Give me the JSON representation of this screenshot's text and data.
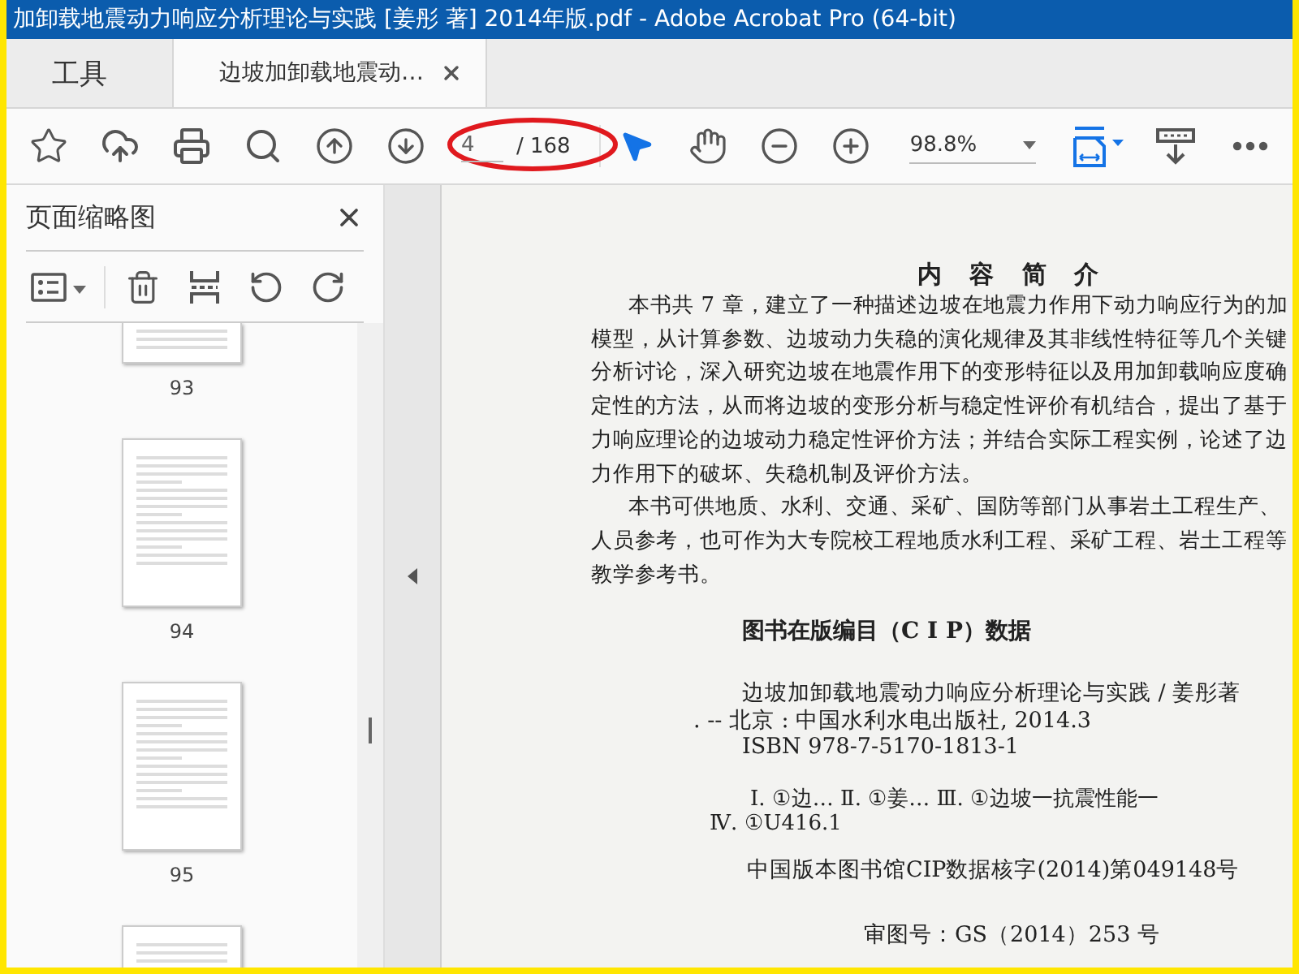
{
  "window": {
    "title": "加卸载地震动力响应分析理论与实践 [姜彤 著] 2014年版.pdf - Adobe Acrobat Pro (64-bit)"
  },
  "tabs": [
    {
      "label": "工具",
      "selected": false,
      "closable": false
    },
    {
      "label": "边坡加卸载地震动…",
      "selected": true,
      "closable": true
    }
  ],
  "toolbar": {
    "page_input": "4",
    "page_total": "/ 168",
    "zoom": "98.8%"
  },
  "sidebar": {
    "title": "页面缩略图",
    "thumbnails": [
      {
        "kind": "top_cut",
        "label": "93"
      },
      {
        "kind": "full",
        "label": "94"
      },
      {
        "kind": "full",
        "label": "95"
      },
      {
        "kind": "bottom_cut"
      }
    ]
  },
  "document": {
    "lines": [
      {
        "kind": "heading",
        "text": "内 容 简 介"
      },
      {
        "kind": "para_first",
        "text": "本书共 7 章，建立了一种描述边坡在地震力作用下动力响应行为的加"
      },
      {
        "kind": "para",
        "text": "模型，从计算参数、边坡动力失稳的演化规律及其非线性特征等几个关键"
      },
      {
        "kind": "para",
        "text": "分析讨论，深入研究边坡在地震作用下的变形特征以及用加卸载响应度确"
      },
      {
        "kind": "para",
        "text": "定性的方法，从而将边坡的变形分析与稳定性评价有机结合，提出了基于"
      },
      {
        "kind": "para",
        "text": "力响应理论的边坡动力稳定性评价方法；并结合实际工程实例，论述了边"
      },
      {
        "kind": "para",
        "text": "力作用下的破坏、失稳机制及评价方法。"
      },
      {
        "kind": "para_first",
        "text": "本书可供地质、水利、交通、采矿、国防等部门从事岩土工程生产、"
      },
      {
        "kind": "para",
        "text": "人员参考，也可作为大专院校工程地质水利工程、采矿工程、岩土工程等"
      },
      {
        "kind": "para",
        "text": "教学参考书。"
      },
      {
        "kind": "cip_title",
        "text": "图书在版编目（C I P）数据"
      },
      {
        "kind": "entry_title",
        "text": "边坡加卸载地震动力响应分析理论与实践 / 姜彤著"
      },
      {
        "kind": "entry_cont",
        "text": ". -- 北京 : 中国水利水电出版社, 2014.3"
      },
      {
        "kind": "entry",
        "text": "ISBN 978-7-5170-1813-1"
      },
      {
        "kind": "class",
        "text": "Ⅰ. ①边… Ⅱ. ①姜… Ⅲ. ①边坡一抗震性能一"
      },
      {
        "kind": "class_cont",
        "text": "Ⅳ. ①U416.1"
      },
      {
        "kind": "cip_number",
        "text": "中国版本图书馆CIP数据核字(2014)第049148号"
      },
      {
        "kind": "map_number",
        "text": "审图号：GS（2014）253 号"
      }
    ]
  }
}
